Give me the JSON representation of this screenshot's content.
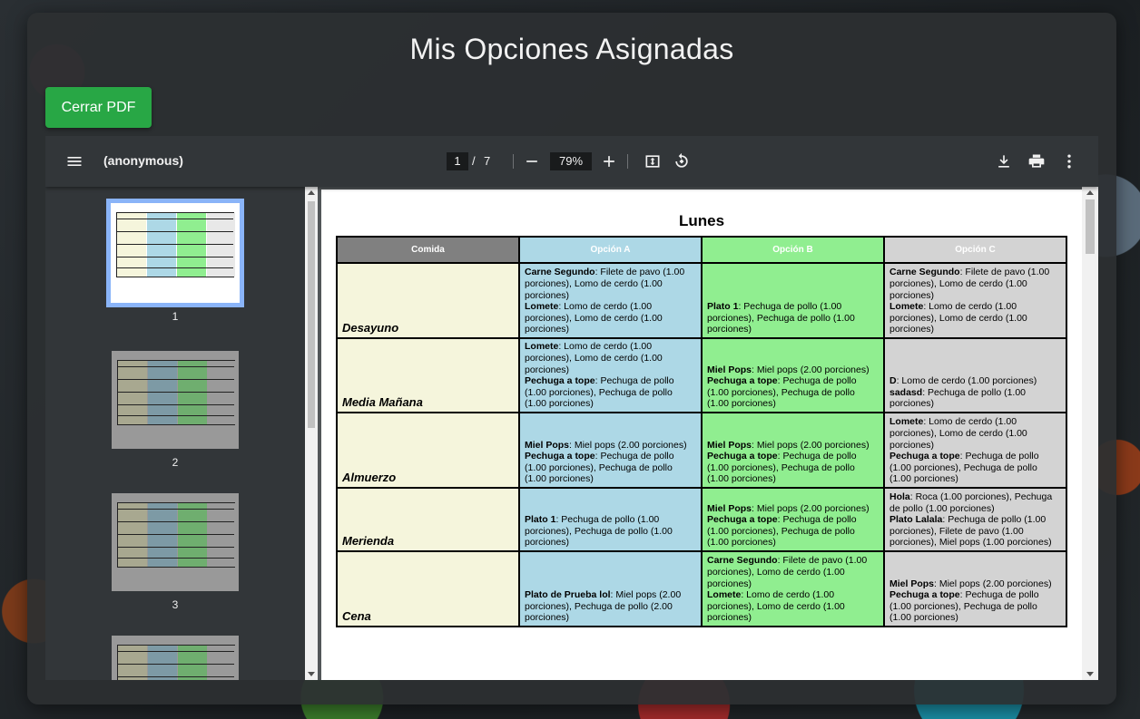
{
  "page": {
    "title": "Mis Opciones Asignadas",
    "close_label": "Cerrar PDF"
  },
  "toolbar": {
    "doc_title": "(anonymous)",
    "current_page": "1",
    "separator": "/",
    "total_pages": "7",
    "zoom": "79%"
  },
  "thumbnails": [
    {
      "label": "1",
      "active": true
    },
    {
      "label": "2",
      "active": false
    },
    {
      "label": "3",
      "active": false
    }
  ],
  "pdf": {
    "day": "Lunes",
    "headers": [
      "Comida",
      "Opción A",
      "Opción B",
      "Opción C"
    ],
    "rows": [
      {
        "meal": "Desayuno",
        "a": [
          [
            "Carne Segundo",
            ": Filete de pavo (1.00 porciones), Lomo de cerdo (1.00 porciones)"
          ],
          [
            "Lomete",
            ": Lomo de cerdo (1.00 porciones), Lomo de cerdo (1.00 porciones)"
          ]
        ],
        "b": [
          [
            "Plato 1",
            ": Pechuga de pollo (1.00 porciones), Pechuga de pollo (1.00 porciones)"
          ]
        ],
        "c": [
          [
            "Carne Segundo",
            ": Filete de pavo (1.00 porciones), Lomo de cerdo (1.00 porciones)"
          ],
          [
            "Lomete",
            ": Lomo de cerdo (1.00 porciones), Lomo de cerdo (1.00 porciones)"
          ]
        ]
      },
      {
        "meal": "Media Mañana",
        "a": [
          [
            "Lomete",
            ": Lomo de cerdo (1.00 porciones), Lomo de cerdo (1.00 porciones)"
          ],
          [
            "Pechuga a tope",
            ": Pechuga de pollo (1.00 porciones), Pechuga de pollo (1.00 porciones)"
          ]
        ],
        "b": [
          [
            "Miel Pops",
            ": Miel pops (2.00 porciones)"
          ],
          [
            "Pechuga a tope",
            ": Pechuga de pollo (1.00 porciones), Pechuga de pollo (1.00 porciones)"
          ]
        ],
        "c": [
          [
            "D",
            ": Lomo de cerdo (1.00 porciones)"
          ],
          [
            "sadasd",
            ": Pechuga de pollo (1.00 porciones)"
          ]
        ]
      },
      {
        "meal": "Almuerzo",
        "a": [
          [
            "Miel Pops",
            ": Miel pops (2.00 porciones)"
          ],
          [
            "Pechuga a tope",
            ": Pechuga de pollo (1.00 porciones), Pechuga de pollo (1.00 porciones)"
          ]
        ],
        "b": [
          [
            "Miel Pops",
            ": Miel pops (2.00 porciones)"
          ],
          [
            "Pechuga a tope",
            ": Pechuga de pollo (1.00 porciones), Pechuga de pollo (1.00 porciones)"
          ]
        ],
        "c": [
          [
            "Lomete",
            ": Lomo de cerdo (1.00 porciones), Lomo de cerdo (1.00 porciones)"
          ],
          [
            "Pechuga a tope",
            ": Pechuga de pollo (1.00 porciones), Pechuga de pollo (1.00 porciones)"
          ]
        ]
      },
      {
        "meal": "Merienda",
        "a": [
          [
            "Plato 1",
            ": Pechuga de pollo (1.00 porciones), Pechuga de pollo (1.00 porciones)"
          ]
        ],
        "b": [
          [
            "Miel Pops",
            ": Miel pops (2.00 porciones)"
          ],
          [
            "Pechuga a tope",
            ": Pechuga de pollo (1.00 porciones), Pechuga de pollo (1.00 porciones)"
          ]
        ],
        "c": [
          [
            "Hola",
            ": Roca (1.00 porciones), Pechuga de pollo (1.00 porciones)"
          ],
          [
            "Plato Lalala",
            ": Pechuga de pollo (1.00 porciones), Filete de pavo (1.00 porciones), Miel pops (1.00 porciones)"
          ]
        ]
      },
      {
        "meal": "Cena",
        "a": [
          [
            "Plato de Prueba lol",
            ": Miel pops (2.00 porciones), Pechuga de pollo (2.00 porciones)"
          ]
        ],
        "b": [
          [
            "Carne Segundo",
            ": Filete de pavo (1.00 porciones), Lomo de cerdo (1.00 porciones)"
          ],
          [
            "Lomete",
            ": Lomo de cerdo (1.00 porciones), Lomo de cerdo (1.00 porciones)"
          ]
        ],
        "c": [
          [
            "Miel Pops",
            ": Miel pops (2.00 porciones)"
          ],
          [
            "Pechuga a tope",
            ": Pechuga de pollo (1.00 porciones), Pechuga de pollo (1.00 porciones)"
          ]
        ]
      }
    ]
  },
  "colors": {
    "accent": "#28a745",
    "header_meal": "#808080",
    "col_meal": "#f5f5dc",
    "col_a": "#add8e6",
    "col_b": "#90ee90",
    "col_c": "#d3d3d3"
  },
  "icons": {
    "menu": "menu-icon",
    "zoom_out": "minus-icon",
    "zoom_in": "plus-icon",
    "fit": "fit-page-icon",
    "rotate": "rotate-icon",
    "download": "download-icon",
    "print": "print-icon",
    "more": "more-vert-icon"
  }
}
